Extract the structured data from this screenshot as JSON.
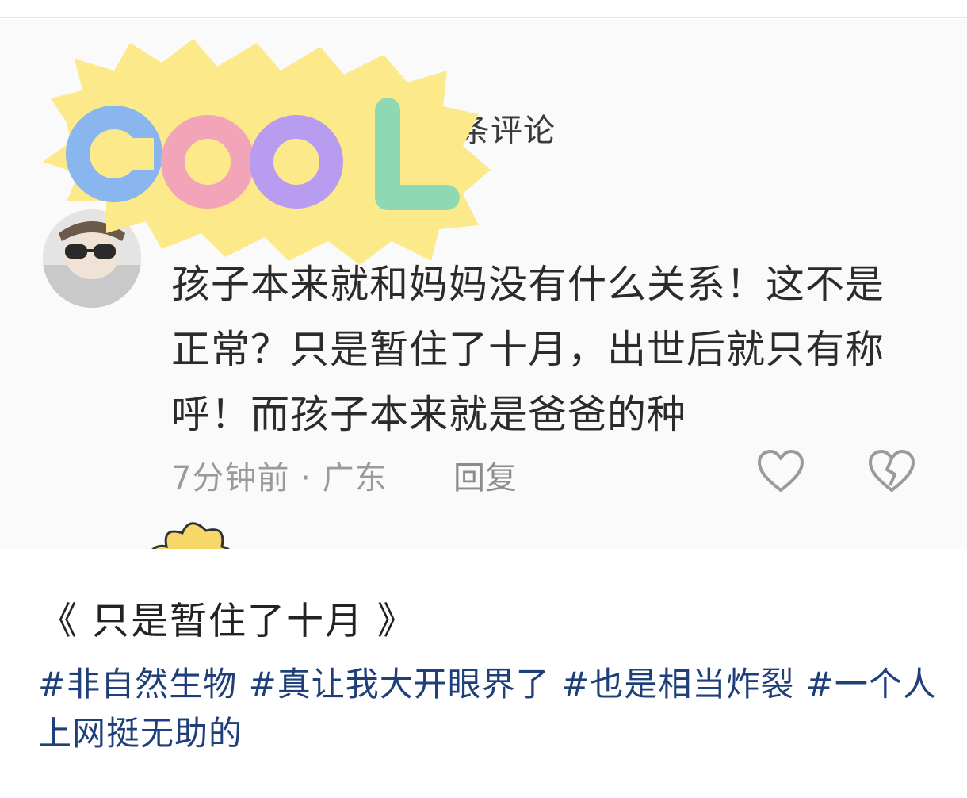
{
  "screenshot": {
    "sticker": {
      "text": "COOL",
      "colors": [
        "#8ab6f0",
        "#f2a5b8",
        "#b79cf0",
        "#8ed9b3"
      ],
      "bg": "#fbe98a"
    },
    "comment_count_label": "条评论",
    "comment": {
      "line1": "孩子本来就和妈妈没有什么关系！这不是",
      "line2": "正常？只是暂住了十月，出世后就只有称",
      "line3": "呼！而孩子本来就是爸爸的种"
    },
    "meta": "7分钟前 · 广东",
    "reply_label": "回复",
    "like_icon": "heart-icon",
    "dislike_icon": "broken-heart-icon"
  },
  "post": {
    "title": "《 只是暂住了十月 》",
    "tags": [
      "#非自然生物",
      "#真让我大开眼界了",
      "#也是相当炸裂",
      "#一个人上网挺无助的"
    ]
  },
  "colors": {
    "tag": "#1f3f7a",
    "meta": "#9a9a9a"
  }
}
